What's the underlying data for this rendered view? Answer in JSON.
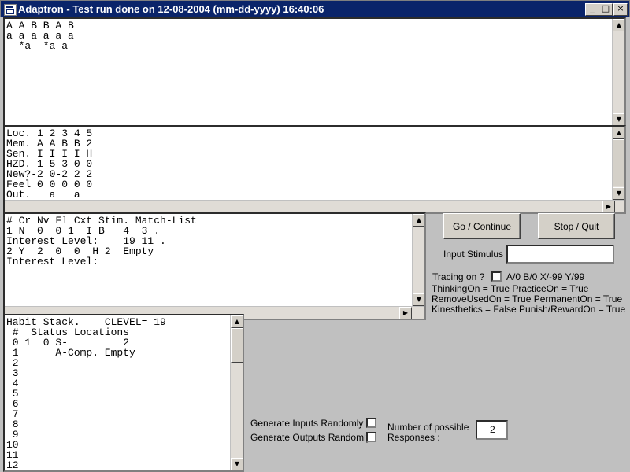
{
  "window": {
    "title": "Adaptron - Test run done on 12-08-2004 (mm-dd-yyyy) 16:40:06",
    "minimize_glyph": "_",
    "maximize_glyph": "□",
    "close_glyph": "×"
  },
  "top_pane": {
    "lines": "A A B B A B\na a a a a a\n  *a  *a a"
  },
  "memory_pane": {
    "lines": "Loc. 1 2 3 4 5\nMem. A A B B 2\nSen. I I I I H\nHZD. 1 5 3 0 0\nNew?-2 0-2 2 2\nFeel 0 0 0 0 0\nOut.   a   a"
  },
  "match_pane": {
    "lines": "# Cr Nv Fl Cxt Stim. Match-List\n1 N  0  0 1  I B   4  3 .\nInterest Level:    19 11 .\n2 Y  2  0  0  H 2  Empty\nInterest Level:"
  },
  "habit_pane": {
    "lines": "Habit Stack.    CLEVEL= 19\n #  Status Locations\n 0 1  0 S-         2\n 1      A-Comp. Empty\n 2\n 3\n 4\n 5\n 6\n 7\n 8\n 9\n10\n11\n12"
  },
  "controls": {
    "go_label": "Go / Continue",
    "stop_label": "Stop / Quit",
    "input_stimulus_label": "Input Stimulus :",
    "input_stimulus_value": "",
    "tracing_label": "Tracing on ?",
    "tracing_checked": false,
    "tracing_hint": "A/0  B/0  X/-99  Y/99",
    "status_line1": "ThinkingOn = True PracticeOn = True",
    "status_line2": "RemoveUsedOn = True PermanentOn = True",
    "status_line3": "Kinesthetics = False Punish/RewardOn = True",
    "gen_inputs_label": "Generate Inputs Randomly ?",
    "gen_inputs_checked": false,
    "gen_outputs_label": "Generate Outputs Randomly?",
    "gen_outputs_checked": false,
    "num_responses_label_1": "Number of possible",
    "num_responses_label_2": "Responses :",
    "num_responses_value": "2"
  }
}
